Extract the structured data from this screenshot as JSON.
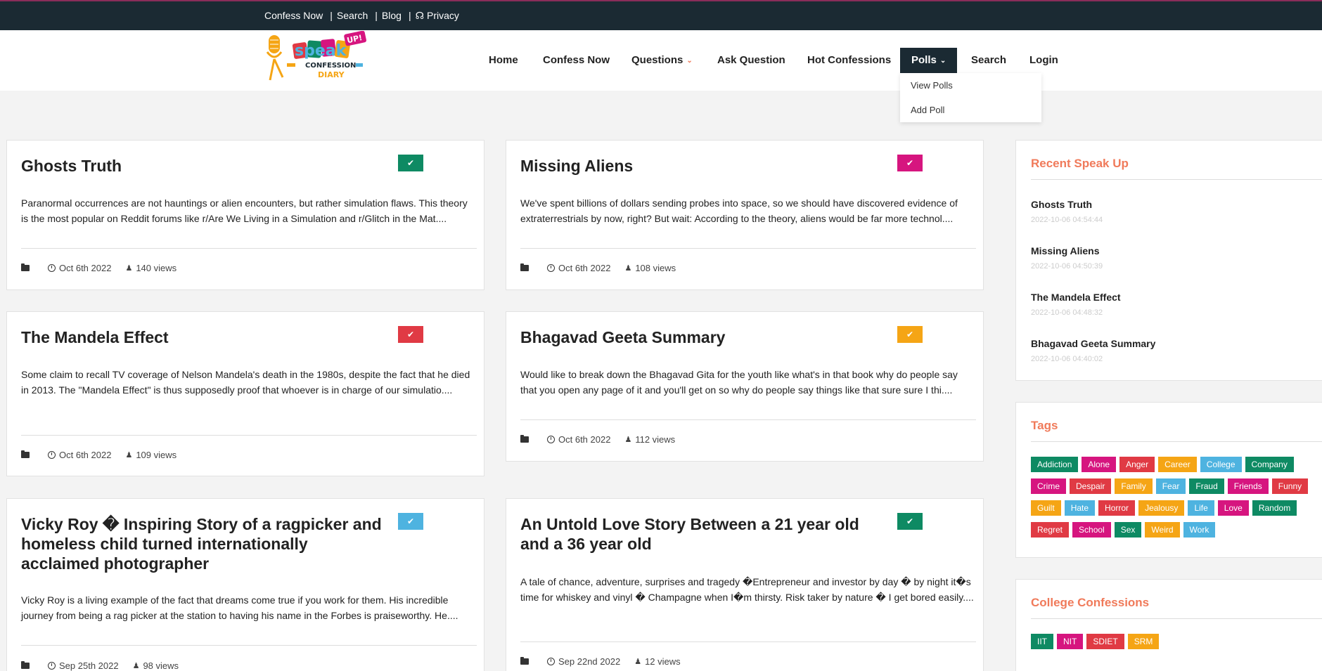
{
  "topbar": {
    "links": [
      "Confess Now",
      "Search",
      "Blog",
      "Privacy"
    ]
  },
  "logo": {
    "text_speak": "speak",
    "text_up": "UP!",
    "text_confession": "CONFESSION",
    "text_diary": "DIARY"
  },
  "nav": {
    "items": [
      "Home",
      "Confess Now",
      "Questions",
      "Ask Question",
      "Hot Confessions",
      "Polls",
      "Search",
      "Login"
    ],
    "active": "Polls"
  },
  "polls_dropdown": [
    "View Polls",
    "Add Poll"
  ],
  "cards": [
    {
      "title": "Ghosts Truth",
      "badge_color": "#0e8a63",
      "excerpt": "Paranormal occurrences are not hauntings or alien encounters, but rather simulation flaws. This theory is the most popular on Reddit forums like r/Are We Living in a Simulation and r/Glitch in the Mat....",
      "date": "Oct 6th 2022",
      "views": "140 views"
    },
    {
      "title": "Missing Aliens",
      "badge_color": "#d6157f",
      "excerpt": "We've spent billions of dollars sending probes into space, so we should have discovered evidence of extraterrestrials by now, right? But wait: According to the theory, aliens would be far more technol....",
      "date": "Oct 6th 2022",
      "views": "108 views"
    },
    {
      "title": "The Mandela Effect",
      "badge_color": "#e03a44",
      "excerpt": "Some claim to recall TV coverage of Nelson Mandela's death in the 1980s, despite the fact that he died in 2013. The \"Mandela Effect\" is thus supposedly proof that whoever is in charge of our simulatio....",
      "date": "Oct 6th 2022",
      "views": "109 views"
    },
    {
      "title": "Bhagavad Geeta Summary",
      "badge_color": "#f5a515",
      "excerpt": "Would like to break down the Bhagavad Gita for the youth like what's in that book why do people say that you open any page of it and you'll get on so why do people say things like that sure sure I thi....",
      "date": "Oct 6th 2022",
      "views": "112 views"
    },
    {
      "title": "Vicky Roy � Inspiring Story of a ragpicker and homeless child turned internationally acclaimed photographer",
      "badge_color": "#4eb3e0",
      "excerpt": "Vicky Roy is a living example of the fact that dreams come true if you work for them. His incredible journey from being a rag picker at the station to having his name in the Forbes is praiseworthy. He....",
      "date": "Sep 25th 2022",
      "views": "98 views"
    },
    {
      "title": "An Untold Love Story Between a 21 year old and a 36 year old",
      "badge_color": "#0e8a63",
      "excerpt": "A tale of chance, adventure, surprises and tragedy �Entrepreneur and investor by day � by night it�s time for whiskey and vinyl � Champagne when I�m thirsty. Risk taker by nature � I get bored easily....",
      "date": "Sep 22nd 2022",
      "views": "12 views"
    }
  ],
  "sidebar": {
    "recent_title": "Recent Speak Up",
    "recent": [
      {
        "title": "Ghosts Truth",
        "date": "2022-10-06 04:54:44"
      },
      {
        "title": "Missing Aliens",
        "date": "2022-10-06 04:50:39"
      },
      {
        "title": "The Mandela Effect",
        "date": "2022-10-06 04:48:32"
      },
      {
        "title": "Bhagavad Geeta Summary",
        "date": "2022-10-06 04:40:02"
      }
    ],
    "tags_title": "Tags",
    "tags": [
      {
        "label": "Addiction",
        "color": "#0e8a63"
      },
      {
        "label": "Alone",
        "color": "#d6157f"
      },
      {
        "label": "Anger",
        "color": "#e03a44"
      },
      {
        "label": "Career",
        "color": "#f5a515"
      },
      {
        "label": "College",
        "color": "#4eb3e0"
      },
      {
        "label": "Company",
        "color": "#0e8a63"
      },
      {
        "label": "Crime",
        "color": "#d6157f"
      },
      {
        "label": "Despair",
        "color": "#e03a44"
      },
      {
        "label": "Family",
        "color": "#f5a515"
      },
      {
        "label": "Fear",
        "color": "#4eb3e0"
      },
      {
        "label": "Fraud",
        "color": "#0e8a63"
      },
      {
        "label": "Friends",
        "color": "#d6157f"
      },
      {
        "label": "Funny",
        "color": "#e03a44"
      },
      {
        "label": "Guilt",
        "color": "#f5a515"
      },
      {
        "label": "Hate",
        "color": "#4eb3e0"
      },
      {
        "label": "Horror",
        "color": "#e03a44"
      },
      {
        "label": "Jealousy",
        "color": "#f5a515"
      },
      {
        "label": "Life",
        "color": "#4eb3e0"
      },
      {
        "label": "Love",
        "color": "#d6157f"
      },
      {
        "label": "Random",
        "color": "#0e8a63"
      },
      {
        "label": "Regret",
        "color": "#e03a44"
      },
      {
        "label": "School",
        "color": "#d6157f"
      },
      {
        "label": "Sex",
        "color": "#0e8a63"
      },
      {
        "label": "Weird",
        "color": "#f5a515"
      },
      {
        "label": "Work",
        "color": "#4eb3e0"
      }
    ],
    "college_title": "College Confessions",
    "colleges": [
      {
        "label": "IIT",
        "color": "#0e8a63"
      },
      {
        "label": "NIT",
        "color": "#d6157f"
      },
      {
        "label": "SDIET",
        "color": "#e03a44"
      },
      {
        "label": "SRM",
        "color": "#f5a515"
      }
    ]
  }
}
